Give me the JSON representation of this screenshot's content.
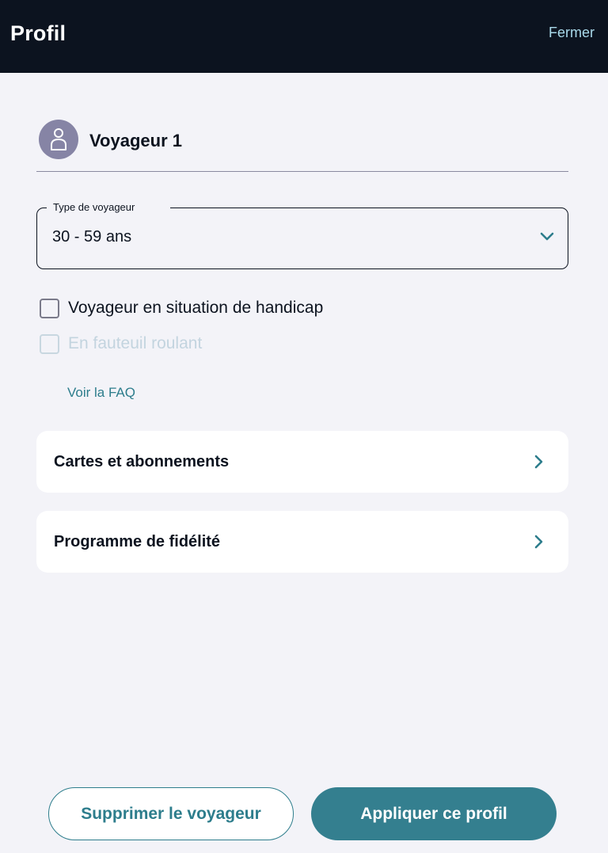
{
  "header": {
    "title": "Profil",
    "close_label": "Fermer"
  },
  "traveler": {
    "name": "Voyageur 1",
    "avatar_icon": "person-icon"
  },
  "traveler_type": {
    "legend": "Type de voyageur",
    "value": "30 - 59 ans"
  },
  "options": {
    "handicap_label": "Voyageur en situation de handicap",
    "handicap_checked": false,
    "wheelchair_label": "En fauteuil roulant",
    "wheelchair_disabled": true
  },
  "faq_link": "Voir la FAQ",
  "cards": {
    "cards_label": "Cartes et abonnements",
    "loyalty_label": "Programme de fidélité"
  },
  "footer": {
    "delete_label": "Supprimer le voyageur",
    "apply_label": "Appliquer ce profil"
  },
  "colors": {
    "header_bg": "#0c131f",
    "accent": "#347f8f",
    "link": "#2d7d8c",
    "avatar_bg": "#8684a5",
    "page_bg": "#f3f3f8"
  }
}
